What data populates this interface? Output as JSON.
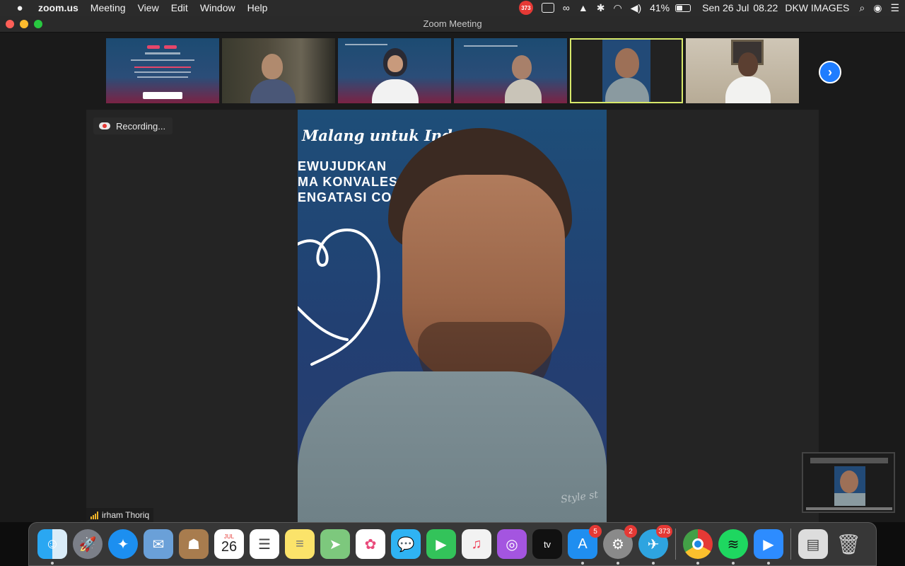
{
  "menubar": {
    "app_name": "zoom.us",
    "menus": [
      "Meeting",
      "View",
      "Edit",
      "Window",
      "Help"
    ],
    "notification_count": "373",
    "battery_percent": "41%",
    "battery_level": 0.41,
    "date": "Sen 26 Jul",
    "time": "08.22",
    "user_label": "DKW IMAGES"
  },
  "window": {
    "title": "Zoom Meeting"
  },
  "recording": {
    "label": "Recording..."
  },
  "main_speaker": {
    "name": "irham Thoriq",
    "slide_line_1": "Malang untuk Indo",
    "slide_line_2": "EWUJUDKAN",
    "slide_line_3": "MA KONVALES",
    "slide_line_4": "ENGATASI CO",
    "shirt_text": "Style st"
  },
  "dock": {
    "calendar_month": "JUL",
    "calendar_day": "26",
    "appstore_badge": "5",
    "settings_badge": "2",
    "telegram_badge": "373",
    "tv_label": "tv"
  },
  "colors": {
    "active_speaker_border": "#d7e86a",
    "next_button": "#1f7dff",
    "recording_dot": "#e53935"
  }
}
